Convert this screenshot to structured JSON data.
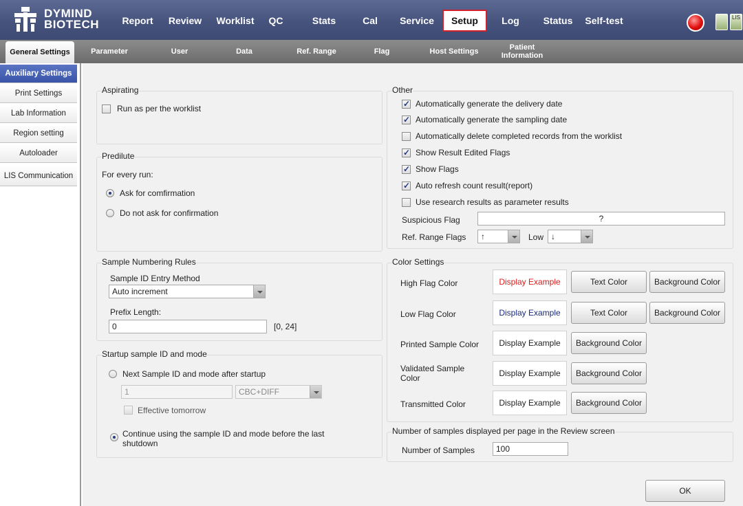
{
  "brand": {
    "line1": "DYMIND",
    "line2": "BIOTECH"
  },
  "nav": {
    "report": "Report",
    "review": "Review",
    "worklist": "Worklist",
    "qc": "QC",
    "stats": "Stats",
    "cal": "Cal",
    "service": "Service",
    "setup": "Setup",
    "log": "Log",
    "status": "Status",
    "selftest": "Self-test"
  },
  "tray": {
    "lis_label": "LIS"
  },
  "subtabs": {
    "general": "General Settings",
    "parameter": "Parameter",
    "user": "User",
    "data": "Data",
    "refrange": "Ref. Range",
    "flag": "Flag",
    "host": "Host Settings",
    "patient": "Patient Information"
  },
  "sidebar": {
    "auxiliary": "Auxiliary Settings",
    "print": "Print Settings",
    "lab": "Lab Information",
    "region": "Region setting",
    "autoloader": "Autoloader",
    "lis": "LIS Communication"
  },
  "aspirating": {
    "title": "Aspirating",
    "run_worklist": "Run as per the worklist"
  },
  "predilute": {
    "title": "Predilute",
    "every_run": "For every run:",
    "ask": "Ask for comfirmation",
    "no_ask": "Do not ask for confirmation"
  },
  "numbering": {
    "title": "Sample Numbering Rules",
    "entry_method_label": "Sample ID Entry Method",
    "entry_method_value": "Auto increment",
    "prefix_label": "Prefix Length:",
    "prefix_value": "0",
    "prefix_range": "[0, 24]"
  },
  "startup": {
    "title": "Startup sample ID and mode",
    "next_option": "Next Sample ID and mode after startup",
    "next_id": "1",
    "mode": "CBC+DIFF",
    "effective_tomorrow": "Effective tomorrow",
    "continue_option": "Continue using the sample ID and mode before the last shutdown"
  },
  "other": {
    "title": "Other",
    "auto_delivery": "Automatically generate the delivery date",
    "auto_sampling": "Automatically generate the sampling date",
    "auto_delete": "Automatically delete completed records from the worklist",
    "show_edited": "Show Result Edited Flags",
    "show_flags": "Show Flags",
    "auto_refresh": "Auto refresh count result(report)",
    "use_research": "Use research results as parameter results",
    "suspicious_label": "Suspicious Flag",
    "suspicious_value": "?",
    "refrange_label": "Ref. Range Flags",
    "high_value": "↑",
    "low_label": "Low",
    "low_value": "↓"
  },
  "colors": {
    "title": "Color Settings",
    "high_label": "High Flag Color",
    "low_label": "Low Flag Color",
    "printed_label": "Printed Sample Color",
    "validated_label": "Validated Sample Color",
    "transmitted_label": "Transmitted Color",
    "example": "Display Example",
    "text_color": "Text Color",
    "bg_color": "Background Color",
    "high_text_hex": "#e01818",
    "low_text_hex": "#1a2a80"
  },
  "review": {
    "title": "Number of samples displayed per page in the Review screen",
    "label": "Number of Samples",
    "value": "100"
  },
  "ok": "OK"
}
